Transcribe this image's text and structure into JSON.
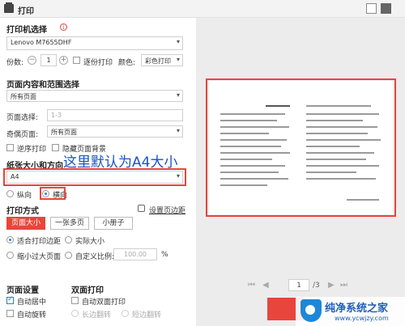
{
  "window": {
    "title": "打印"
  },
  "printer": {
    "heading": "打印机选择",
    "selected": "Lenovo M7655DHF"
  },
  "copies": {
    "label": "份数:",
    "value": "1",
    "collate_label": "逐份打印",
    "color_label": "颜色:",
    "color_value": "彩色打印"
  },
  "range": {
    "heading": "页面内容和范围选择",
    "content_value": "所有页面",
    "page_select_label": "页面选择:",
    "page_select_placeholder": "1-3",
    "odd_even_label": "奇偶页面:",
    "odd_even_value": "所有页面",
    "reverse_label": "逆序打印",
    "hide_bg_label": "隐藏页面背景"
  },
  "paper": {
    "heading": "纸张大小和方向",
    "size_value": "A4",
    "portrait_label": "纵向",
    "landscape_label": "横向"
  },
  "annotation": "这里默认为A4大小",
  "mode": {
    "heading": "打印方式",
    "margin_link": "设置页边距",
    "buttons": [
      "页面大小",
      "一张多页",
      "小册子"
    ],
    "fit_margin_label": "适合打印边距",
    "actual_size_label": "实际大小",
    "shrink_label": "缩小过大页面",
    "custom_scale_label": "自定义比例:",
    "scale_value": "100.00",
    "percent": "%"
  },
  "page_settings": {
    "heading": "页面设置",
    "auto_center_label": "自动居中",
    "auto_rotate_label": "自动旋转"
  },
  "duplex": {
    "heading": "双面打印",
    "auto_duplex_label": "自动双面打印",
    "long_edge_label": "长边翻转",
    "short_edge_label": "短边翻转"
  },
  "preview": {
    "current_page": "1",
    "total_pages": "/3"
  },
  "watermark": {
    "title": "纯净系统之家",
    "url": "www.ycwjzy.com"
  }
}
